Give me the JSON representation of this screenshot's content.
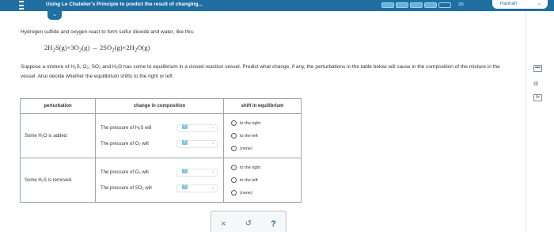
{
  "header": {
    "title": "Using Le Chatelier's Principle to predict the result of changing...",
    "progress_segments_filled": 4,
    "progress_segments_total": 5,
    "progress_count": "3/5",
    "user_name": "Hannah",
    "collapse_icon": "chevron-down-icon"
  },
  "question": {
    "intro": "Hydrogen sulfide and oxygen react to form sulfur dioxide and water, like this:",
    "prompt": "Suppose a mixture of H₂S, O₂, SO₂ and H₂O has come to equilibrium in a closed reaction vessel. Predict what change, if any, the perturbations in the table below will cause in the composition of the mixture in the vessel. Also decide whether the equilibrium shifts to the right or left."
  },
  "table": {
    "headers": [
      "perturbation",
      "change in composition",
      "shift in equilibrium"
    ],
    "rows": [
      {
        "perturbation": "Some H₂O is added.",
        "changes": [
          {
            "label": "The pressure of H₂S will",
            "selected": "?"
          },
          {
            "label": "The pressure of O₂ will",
            "selected": "?"
          }
        ],
        "shift_options": [
          "to the right",
          "to the left",
          "(none)"
        ]
      },
      {
        "perturbation": "Some H₂S is removed.",
        "changes": [
          {
            "label": "The pressure of O₂ will",
            "selected": "?"
          },
          {
            "label": "The pressure of SO₂ will",
            "selected": "?"
          }
        ],
        "shift_options": [
          "to the right",
          "to the left",
          "(none)"
        ]
      }
    ]
  },
  "actions": {
    "clear": "×",
    "undo": "↺",
    "help": "?"
  },
  "rail": {
    "icons": [
      "calculator-icon",
      "bar-chart-icon",
      "periodic-table-icon"
    ]
  },
  "colors": {
    "header_bg": "#1f6fa3",
    "progress_fill": "#62b5de",
    "select_badge": "#7fc3e3"
  }
}
